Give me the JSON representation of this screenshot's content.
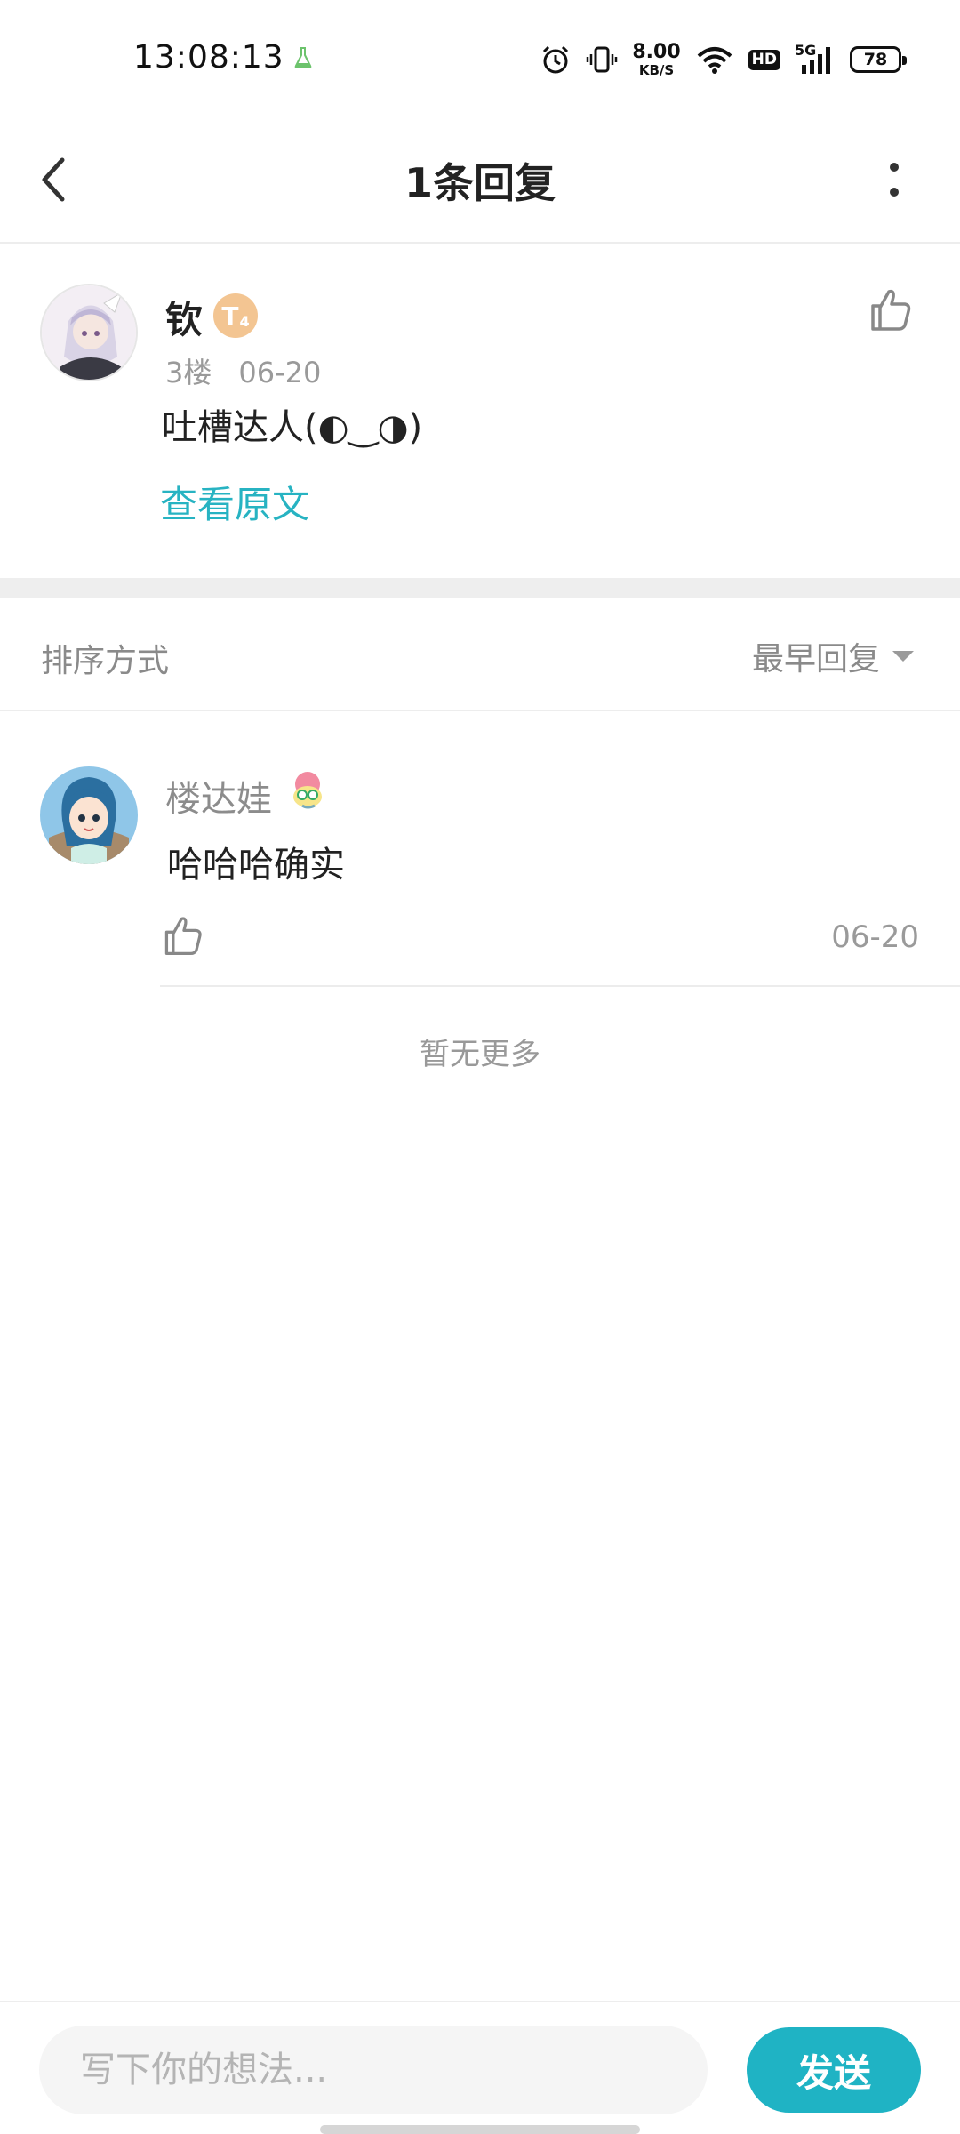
{
  "status_bar": {
    "time": "13:08:13",
    "net_speed_value": "8.00",
    "net_speed_unit": "KB/S",
    "network": "5G",
    "hd_label": "HD",
    "battery": "78"
  },
  "header": {
    "title": "1条回复",
    "back_icon": "chevron-left-icon",
    "more_icon": "more-vertical-icon"
  },
  "original_comment": {
    "author": "钦",
    "level_badge": "T",
    "level_sub": "4",
    "floor": "3楼",
    "date": "06-20",
    "text": "吐槽达人(◐‿◑)",
    "view_original": "查看原文",
    "like_icon": "thumbs-up-icon"
  },
  "sort": {
    "label": "排序方式",
    "selected": "最早回复"
  },
  "replies": [
    {
      "author": "楼达娃",
      "text": "哈哈哈确实",
      "date": "06-20",
      "like_icon": "thumbs-up-icon"
    }
  ],
  "footer_note": "暂无更多",
  "compose": {
    "placeholder": "写下你的想法...",
    "send_label": "发送"
  },
  "colors": {
    "accent": "#1fb3c4",
    "link": "#27b3c2",
    "badge": "#f3c592"
  }
}
